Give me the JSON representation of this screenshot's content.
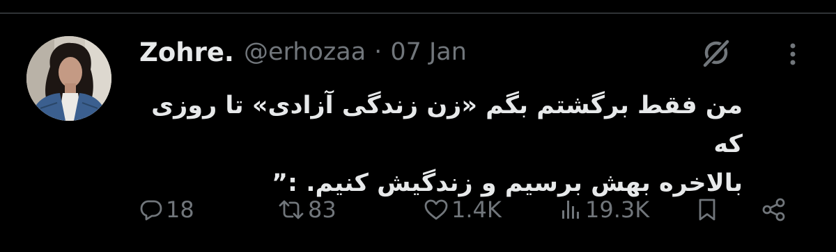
{
  "tweet": {
    "display_name": "Zohre.",
    "handle": "@erhozaa",
    "separator": "·",
    "date": "07 Jan",
    "text": "من فقط برگشتم بگم «زن زندگی آزادی» تا روزی که\nبالاخره بهش برسیم و زندگیش کنیم. :”",
    "avatar_icon": "user-avatar-photo"
  },
  "header_icons": {
    "grok": "grok-icon",
    "more": "more-options-icon"
  },
  "actions": {
    "replies": "18",
    "retweets": "83",
    "likes": "1.4K",
    "views": "19.3K",
    "reply_icon": "reply-icon",
    "retweet_icon": "retweet-icon",
    "like_icon": "heart-icon",
    "views_icon": "views-icon",
    "bookmark_icon": "bookmark-icon",
    "share_icon": "share-icon"
  },
  "colors": {
    "background": "#000000",
    "primary_text": "#e7e9ea",
    "secondary_text": "#71767b",
    "divider": "#2f3336"
  }
}
